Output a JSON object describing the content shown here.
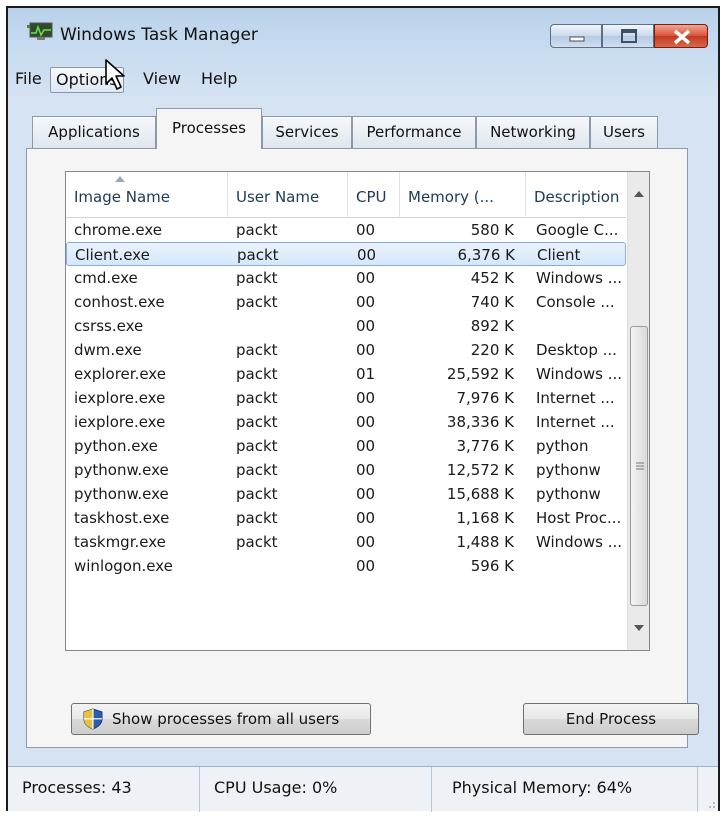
{
  "window": {
    "title": "Windows Task Manager",
    "icon": "task-manager-icon"
  },
  "menu": [
    "File",
    "Options",
    "View",
    "Help"
  ],
  "tabs": [
    {
      "label": "Applications",
      "active": false
    },
    {
      "label": "Processes",
      "active": true
    },
    {
      "label": "Services",
      "active": false
    },
    {
      "label": "Performance",
      "active": false
    },
    {
      "label": "Networking",
      "active": false
    },
    {
      "label": "Users",
      "active": false
    }
  ],
  "table": {
    "columns": [
      "Image Name",
      "User Name",
      "CPU",
      "Memory (...",
      "Description"
    ],
    "sorted_column": "Image Name",
    "rows": [
      {
        "name": "chrome.exe",
        "user": "packt",
        "cpu": "00",
        "mem": "580 K",
        "desc": "Google C..."
      },
      {
        "name": "Client.exe",
        "user": "packt",
        "cpu": "00",
        "mem": "6,376 K",
        "desc": "Client",
        "selected": true
      },
      {
        "name": "cmd.exe",
        "user": "packt",
        "cpu": "00",
        "mem": "452 K",
        "desc": "Windows ..."
      },
      {
        "name": "conhost.exe",
        "user": "packt",
        "cpu": "00",
        "mem": "740 K",
        "desc": "Console ..."
      },
      {
        "name": "csrss.exe",
        "user": "",
        "cpu": "00",
        "mem": "892 K",
        "desc": ""
      },
      {
        "name": "dwm.exe",
        "user": "packt",
        "cpu": "00",
        "mem": "220 K",
        "desc": "Desktop ..."
      },
      {
        "name": "explorer.exe",
        "user": "packt",
        "cpu": "01",
        "mem": "25,592 K",
        "desc": "Windows ..."
      },
      {
        "name": "iexplore.exe",
        "user": "packt",
        "cpu": "00",
        "mem": "7,976 K",
        "desc": "Internet ..."
      },
      {
        "name": "iexplore.exe",
        "user": "packt",
        "cpu": "00",
        "mem": "38,336 K",
        "desc": "Internet ..."
      },
      {
        "name": "python.exe",
        "user": "packt",
        "cpu": "00",
        "mem": "3,776 K",
        "desc": "python"
      },
      {
        "name": "pythonw.exe",
        "user": "packt",
        "cpu": "00",
        "mem": "12,572 K",
        "desc": "pythonw"
      },
      {
        "name": "pythonw.exe",
        "user": "packt",
        "cpu": "00",
        "mem": "15,688 K",
        "desc": "pythonw"
      },
      {
        "name": "taskhost.exe",
        "user": "packt",
        "cpu": "00",
        "mem": "1,168 K",
        "desc": "Host Proc..."
      },
      {
        "name": "taskmgr.exe",
        "user": "packt",
        "cpu": "00",
        "mem": "1,488 K",
        "desc": "Windows ..."
      },
      {
        "name": "winlogon.exe",
        "user": "",
        "cpu": "00",
        "mem": "596 K",
        "desc": ""
      }
    ]
  },
  "buttons": {
    "show_all": "Show processes from all users",
    "end_process": "End Process"
  },
  "status": {
    "processes": "Processes: 43",
    "cpu": "CPU Usage: 0%",
    "memory": "Physical Memory: 64%"
  },
  "colors": {
    "selection_border": "#84acdd",
    "close_button": "#c13a20",
    "frame_blue": "#b9d1ea"
  }
}
